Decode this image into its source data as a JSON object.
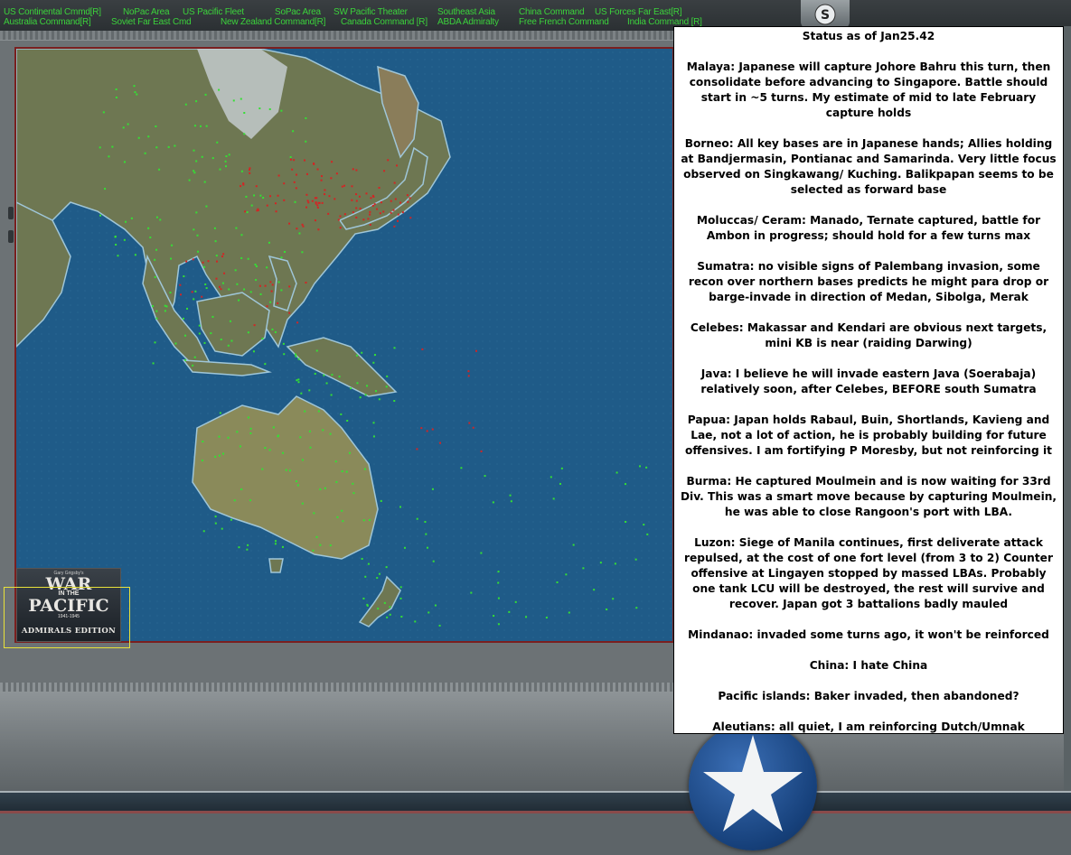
{
  "commands": [
    {
      "id": "us-continental",
      "label": "US Continental Cmmd[R]"
    },
    {
      "id": "nopac",
      "label": "NoPac Area"
    },
    {
      "id": "us-pacific-fleet",
      "label": "US Pacific Fleet"
    },
    {
      "id": "sopac",
      "label": "SoPac Area"
    },
    {
      "id": "sw-pacific",
      "label": "SW Pacific Theater"
    },
    {
      "id": "southeast-asia",
      "label": "Southeast Asia"
    },
    {
      "id": "china",
      "label": "China Command"
    },
    {
      "id": "us-forces-far-east",
      "label": "US Forces Far East[R]"
    },
    {
      "id": "australia",
      "label": "Australia Command[R]"
    },
    {
      "id": "soviet-far-east",
      "label": "Soviet Far East Cmd"
    },
    {
      "id": "new-zealand",
      "label": "New Zealand Command[R]"
    },
    {
      "id": "canada",
      "label": "Canada Command [R]"
    },
    {
      "id": "abda",
      "label": "ABDA Admiralty"
    },
    {
      "id": "free-french",
      "label": "Free French Command"
    },
    {
      "id": "india",
      "label": "India Command [R]"
    }
  ],
  "logo": {
    "top_line": "Gary Grigsby's",
    "war": "WAR",
    "in_the": "IN THE",
    "pacific": "PACIFIC",
    "years": "1941-1945",
    "edition": "ADMIRALS EDITION"
  },
  "topicon": {
    "glyph": "S"
  },
  "notes": {
    "title": "Status as of  Jan25.42",
    "paragraphs": [
      "Malaya: Japanese will capture Johore Bahru this turn, then consolidate before advancing to Singapore. Battle should start in ~5 turns. My estimate of mid to late February capture holds",
      "Borneo: All key bases are in Japanese hands; Allies holding at Bandjermasin, Pontianac and Samarinda. Very little focus observed on Singkawang/ Kuching. Balikpapan seems to be selected as forward base",
      "Moluccas/ Ceram: Manado, Ternate captured, battle for Ambon in progress; should hold for a few turns max",
      "Sumatra: no visible signs of Palembang invasion, some recon over northern bases predicts he might para drop or barge-invade in direction of Medan, Sibolga, Merak",
      "Celebes: Makassar and Kendari are obvious next targets, mini KB is near (raiding Darwing)",
      "Java: I believe he will invade eastern Java (Soerabaja) relatively soon, after Celebes, BEFORE south Sumatra",
      "Papua: Japan holds Rabaul, Buin, Shortlands, Kavieng and Lae, not a lot of action, he is probably building for future offensives. I am fortifying P Moresby, but not reinforcing it",
      "Burma: He captured Moulmein and is now waiting for 33rd Div. This was a smart move because by capturing Moulmein, he was able to close Rangoon's port with LBA.",
      "Luzon:  Siege of Manila continues, first deliverate attack repulsed, at the cost of one fort level (from 3 to 2) Counter offensive at Lingayen stopped by massed LBAs. Probably one tank LCU will be destroyed, the rest will survive and recover. Japan got 3 battalions badly mauled",
      "Mindanao: invaded some turns ago, it won't be reinforced",
      "China: I hate China",
      "Pacific islands: Baker invaded, then abandoned?",
      "Aleutians: all quiet, I am reinforcing Dutch/Umnak"
    ]
  },
  "colors": {
    "command_text": "#3bd23b",
    "ocean": "#1d5a86",
    "land": "#6f7a52",
    "allied_base": "#34e034",
    "japanese_base": "#d42424",
    "map_border": "#7a1f1f",
    "logo_selection": "#e8e23a"
  }
}
